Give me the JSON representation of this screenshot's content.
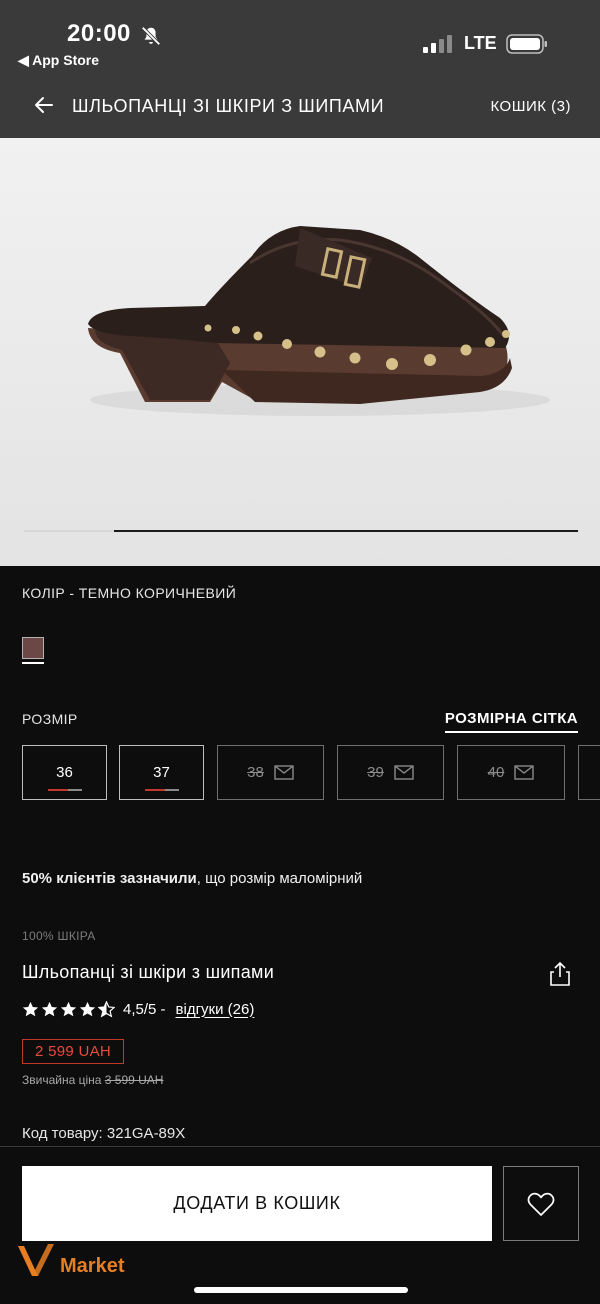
{
  "status_bar": {
    "time": "20:00",
    "back_app": "◀ App Store",
    "network": "LTE",
    "icons": [
      "bell-slash-icon",
      "signal-icon",
      "battery-icon"
    ]
  },
  "header": {
    "title": "ШЛЬОПАНЦІ ЗІ ШКІРИ З ШИПАМИ",
    "cart": "КОШИК (3)",
    "back_icon": "arrow-left-icon"
  },
  "gallery": {
    "image_description": "dark brown leather clog with gold studs and buckle strap",
    "slider_progress": 0.16
  },
  "color": {
    "label": "КОЛІР - ТЕМНО КОРИЧНЕВИЙ",
    "swatch": "#6b4745"
  },
  "size": {
    "label": "РОЗМІР",
    "guide": "РОЗМІРНА СІТКА",
    "options": [
      {
        "value": "36",
        "available": true,
        "low_stock": true
      },
      {
        "value": "37",
        "available": true,
        "low_stock": true
      },
      {
        "value": "38",
        "available": false
      },
      {
        "value": "39",
        "available": false
      },
      {
        "value": "40",
        "available": false
      }
    ]
  },
  "fit_note": {
    "bold": "50% клієнтів зазначили",
    "rest": ", що розмір маломірний"
  },
  "product": {
    "material": "100% ШКІРА",
    "name": "Шльопанці зі шкіри з шипами",
    "rating": 4.5,
    "rating_text": "4,5/5 -",
    "reviews": "відгуки (26)",
    "price": "2 599 UAH",
    "regular_label": "Звичайна ціна ",
    "regular_price": "3 599 UAH",
    "sku": "Код товару: 321GA-89X"
  },
  "actions": {
    "add_to_cart": "ДОДАТИ В КОШИК",
    "wishlist_icon": "heart-icon"
  },
  "watermark": {
    "text": "Market"
  },
  "colors": {
    "background": "#0e0d0d",
    "header": "#3b3a3a",
    "sale": "#c0392b"
  }
}
